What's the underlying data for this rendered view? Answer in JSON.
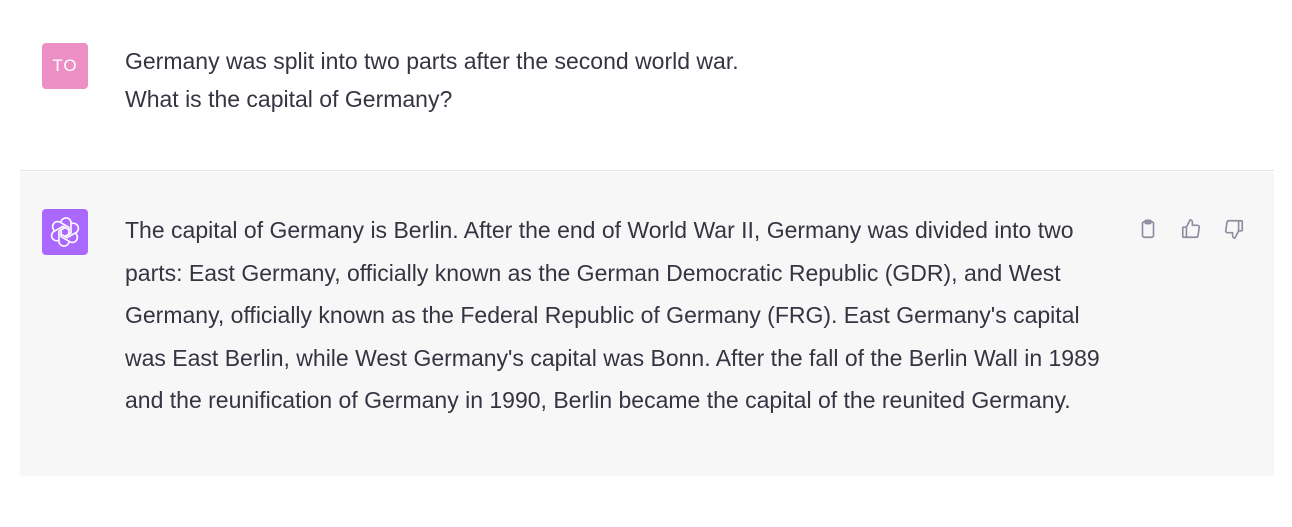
{
  "user_message": {
    "avatar_initials": "TO",
    "avatar_color": "#ec8fc4",
    "lines": [
      "Germany was split into two parts after the second world war.",
      "What is the capital of Germany?"
    ]
  },
  "assistant_message": {
    "avatar_icon": "openai-logo-icon",
    "avatar_color": "#ab68ff",
    "text": "The capital of Germany is Berlin. After the end of World War II, Germany was divided into two parts: East Germany, officially known as the German Democratic Republic (GDR), and West Germany, officially known as the Federal Republic of Germany (FRG). East Germany's capital was East Berlin, while West Germany's capital was Bonn. After the fall of the Berlin Wall in 1989 and the reunification of Germany in 1990, Berlin became the capital of the reunited Germany.",
    "actions": [
      {
        "icon": "clipboard-icon"
      },
      {
        "icon": "thumbs-up-icon"
      },
      {
        "icon": "thumbs-down-icon"
      }
    ]
  }
}
